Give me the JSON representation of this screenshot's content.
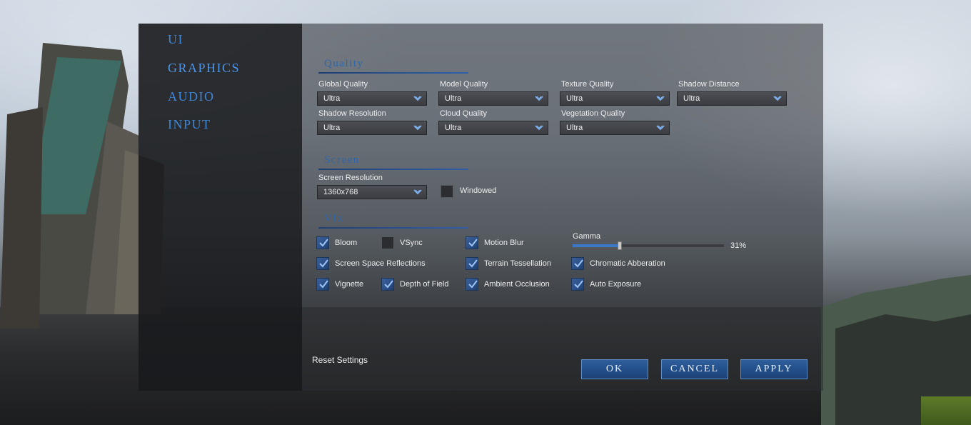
{
  "nav": [
    {
      "label": "UI"
    },
    {
      "label": "GRAPHICS"
    },
    {
      "label": "AUDIO"
    },
    {
      "label": "INPUT"
    }
  ],
  "quality": {
    "title": "Quality",
    "global_quality": {
      "label": "Global Quality",
      "value": "Ultra"
    },
    "model_quality": {
      "label": "Model Quality",
      "value": "Ultra"
    },
    "texture_quality": {
      "label": "Texture Quality",
      "value": "Ultra"
    },
    "shadow_distance": {
      "label": "Shadow Distance",
      "value": "Ultra"
    },
    "shadow_resolution": {
      "label": "Shadow Resolution",
      "value": "Ultra"
    },
    "cloud_quality": {
      "label": "Cloud Quality",
      "value": "Ultra"
    },
    "vegetation_quality": {
      "label": "Vegetation Quality",
      "value": "Ultra"
    }
  },
  "screen": {
    "title": "Screen",
    "resolution": {
      "label": "Screen Resolution",
      "value": "1360x768"
    },
    "windowed": {
      "label": "Windowed",
      "checked": false
    }
  },
  "vfx": {
    "title": "Vfx",
    "bloom": {
      "label": "Bloom",
      "checked": true
    },
    "vsync": {
      "label": "VSync",
      "checked": false
    },
    "motion_blur": {
      "label": "Motion Blur",
      "checked": true
    },
    "ssr": {
      "label": "Screen Space Reflections",
      "checked": true
    },
    "terrain_tessellation": {
      "label": "Terrain Tessellation",
      "checked": true
    },
    "chromatic_abberation": {
      "label": "Chromatic Abberation",
      "checked": true
    },
    "vignette": {
      "label": "Vignette",
      "checked": true
    },
    "depth_of_field": {
      "label": "Depth of Field",
      "checked": true
    },
    "ambient_occlusion": {
      "label": "Ambient Occlusion",
      "checked": true
    },
    "auto_exposure": {
      "label": "Auto Exposure",
      "checked": true
    },
    "gamma": {
      "label": "Gamma",
      "value_text": "31%",
      "fraction": 0.31
    }
  },
  "footer": {
    "reset": "Reset Settings",
    "ok": "OK",
    "cancel": "CANCEL",
    "apply": "APPLY"
  },
  "colors": {
    "accent": "#3e86d8",
    "button": "#23508b",
    "checkbox_checked": "#2b4f86"
  }
}
